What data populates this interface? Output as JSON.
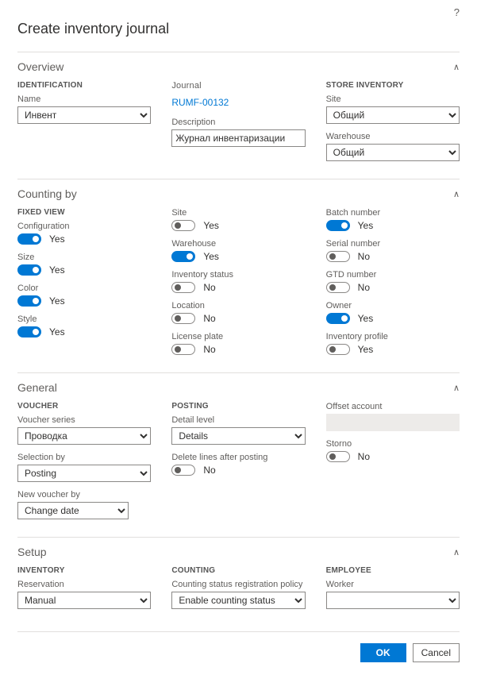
{
  "helpIcon": "?",
  "title": "Create inventory journal",
  "sections": {
    "overview": {
      "title": "Overview",
      "groups": {
        "identification": {
          "heading": "IDENTIFICATION",
          "name": {
            "label": "Name",
            "value": "Инвент"
          }
        },
        "journal": {
          "heading": "Journal",
          "journalId": "RUMF-00132",
          "description": {
            "label": "Description",
            "value": "Журнал инвентаризации"
          }
        },
        "storeInventory": {
          "heading": "STORE INVENTORY",
          "site": {
            "label": "Site",
            "value": "Общий"
          },
          "warehouse": {
            "label": "Warehouse",
            "value": "Общий"
          }
        }
      }
    },
    "countingBy": {
      "title": "Counting by",
      "fixedViewHeading": "FIXED VIEW",
      "toggles": {
        "configuration": {
          "label": "Configuration",
          "value": true,
          "text": "Yes"
        },
        "size": {
          "label": "Size",
          "value": true,
          "text": "Yes"
        },
        "color": {
          "label": "Color",
          "value": true,
          "text": "Yes"
        },
        "style": {
          "label": "Style",
          "value": true,
          "text": "Yes"
        },
        "site": {
          "label": "Site",
          "value": false,
          "text": "Yes"
        },
        "warehouse": {
          "label": "Warehouse",
          "value": true,
          "text": "Yes"
        },
        "inventoryStatus": {
          "label": "Inventory status",
          "value": false,
          "text": "No"
        },
        "location": {
          "label": "Location",
          "value": false,
          "text": "No"
        },
        "licensePlate": {
          "label": "License plate",
          "value": false,
          "text": "No"
        },
        "batchNumber": {
          "label": "Batch number",
          "value": true,
          "text": "Yes"
        },
        "serialNumber": {
          "label": "Serial number",
          "value": false,
          "text": "No"
        },
        "gtdNumber": {
          "label": "GTD number",
          "value": false,
          "text": "No"
        },
        "owner": {
          "label": "Owner",
          "value": true,
          "text": "Yes"
        },
        "inventoryProfile": {
          "label": "Inventory profile",
          "value": false,
          "text": "Yes"
        }
      }
    },
    "general": {
      "title": "General",
      "voucher": {
        "heading": "VOUCHER",
        "voucherSeries": {
          "label": "Voucher series",
          "value": "Проводка"
        },
        "selectionBy": {
          "label": "Selection by",
          "value": "Posting"
        },
        "newVoucherBy": {
          "label": "New voucher by",
          "value": "Change date"
        }
      },
      "posting": {
        "heading": "POSTING",
        "detailLevel": {
          "label": "Detail level",
          "value": "Details"
        },
        "deleteAfter": {
          "label": "Delete lines after posting",
          "value": false,
          "text": "No"
        }
      },
      "offset": {
        "offsetAccount": {
          "label": "Offset account",
          "value": ""
        },
        "storno": {
          "label": "Storno",
          "value": false,
          "text": "No"
        }
      }
    },
    "setup": {
      "title": "Setup",
      "inventory": {
        "heading": "INVENTORY",
        "reservation": {
          "label": "Reservation",
          "value": "Manual"
        }
      },
      "counting": {
        "heading": "COUNTING",
        "policy": {
          "label": "Counting status registration policy",
          "value": "Enable counting status regist..."
        }
      },
      "employee": {
        "heading": "EMPLOYEE",
        "worker": {
          "label": "Worker",
          "value": ""
        }
      }
    }
  },
  "footer": {
    "ok": "OK",
    "cancel": "Cancel"
  },
  "chevron": "∧"
}
